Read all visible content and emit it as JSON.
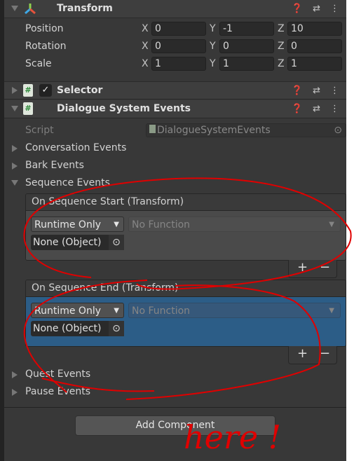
{
  "transform": {
    "title": "Transform",
    "rows": [
      {
        "label": "Position",
        "x": "0",
        "y": "-1",
        "z": "10"
      },
      {
        "label": "Rotation",
        "x": "0",
        "y": "0",
        "z": "0"
      },
      {
        "label": "Scale",
        "x": "1",
        "y": "1",
        "z": "1"
      }
    ],
    "axes": [
      "X",
      "Y",
      "Z"
    ]
  },
  "selector": {
    "title": "Selector",
    "enabled": true
  },
  "dse": {
    "title": "Dialogue System Events",
    "script_label": "Script",
    "script_value": "DialogueSystemEvents",
    "foldouts": [
      "Conversation Events",
      "Bark Events",
      "Sequence Events",
      "Quest Events",
      "Pause Events"
    ],
    "events": [
      {
        "title": "On Sequence Start (Transform)",
        "mode": "Runtime Only",
        "function": "No Function",
        "object": "None (Object)",
        "selected": false
      },
      {
        "title": "On Sequence End (Transform)",
        "mode": "Runtime Only",
        "function": "No Function",
        "object": "None (Object)",
        "selected": true
      }
    ]
  },
  "add_component": "Add Component",
  "annotation": {
    "text": "here !",
    "color": "#e00000"
  },
  "colors": {
    "selection": "#2c5d87"
  }
}
